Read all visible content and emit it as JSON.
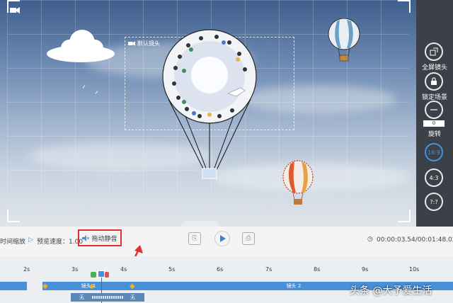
{
  "stage": {
    "camera_label": "默认镜头"
  },
  "sidebar": {
    "fullscreen_label": "全屏镜头",
    "lock_label": "锁定场景",
    "rotate_label": "旋转",
    "rotate_value": "0",
    "ratio_169": "16:9",
    "ratio_43": "4:3",
    "ratio_custom": "?:?"
  },
  "controls": {
    "time_zoom_label": "时间缩放",
    "browse_speed_label": "预览速度：1.00",
    "mute_label": "拖动静音",
    "time_display": "00:00:03.54/00:01:48.02"
  },
  "timeline": {
    "ticks": [
      "2s",
      "3s",
      "4s",
      "5s",
      "6s",
      "7s",
      "8s",
      "9s",
      "10s"
    ],
    "camera_clip_1": "镜头 1",
    "camera_clip_2": "镜头 2",
    "audio_clip_1": "无",
    "audio_clip_2": "无"
  },
  "watermark": "头条 @大予爱生活",
  "colors": {
    "accent": "#4a90d9",
    "highlight": "#e03030"
  }
}
